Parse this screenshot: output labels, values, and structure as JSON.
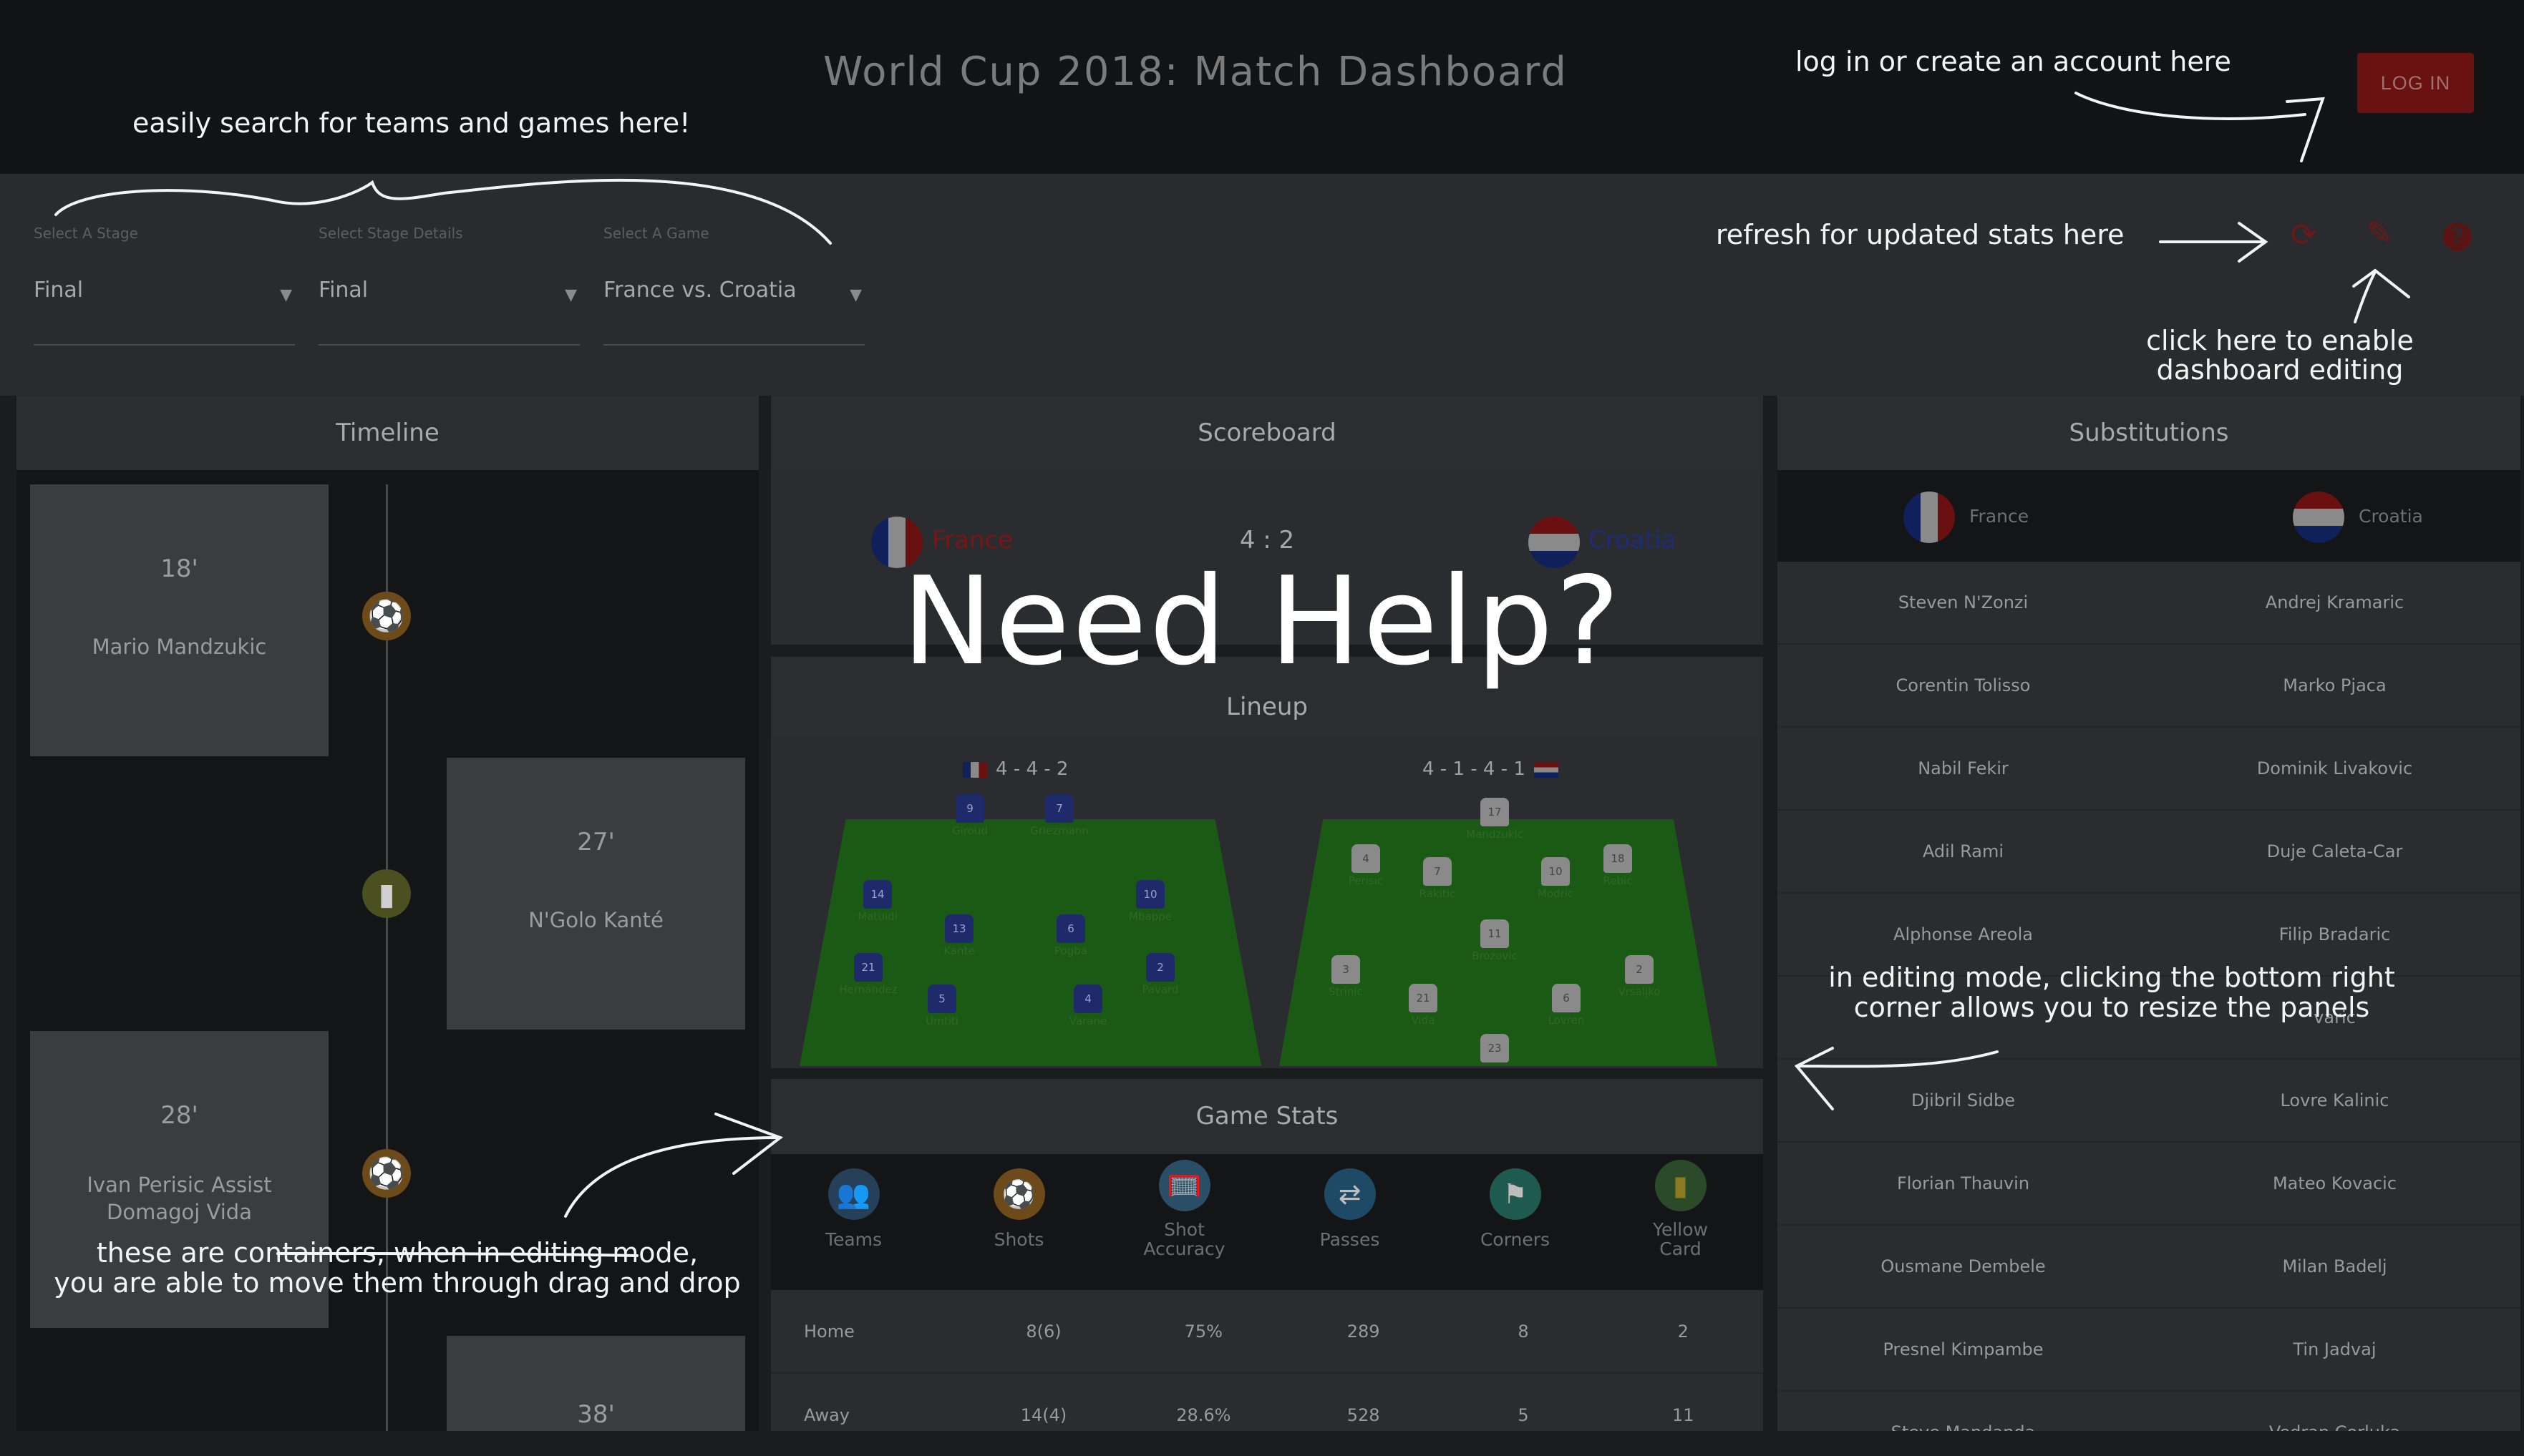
{
  "header": {
    "title": "World Cup 2018: Match Dashboard",
    "login_label": "LOG IN"
  },
  "filters": {
    "stage": {
      "label": "Select A Stage",
      "value": "Final"
    },
    "stage_details": {
      "label": "Select Stage Details",
      "value": "Final"
    },
    "game": {
      "label": "Select A Game",
      "value": "France vs. Croatia"
    }
  },
  "toolbar": {
    "refresh_icon": "refresh-icon",
    "edit_icon": "pencil-icon",
    "help_icon": "help-icon"
  },
  "timeline": {
    "title": "Timeline",
    "events": [
      {
        "minute": "18'",
        "text": "Mario Mandzukic"
      },
      {
        "minute": "27'",
        "text": "N'Golo Kanté"
      },
      {
        "minute": "28'",
        "text_line1": "Ivan Perisic Assist",
        "text_line2": "Domagoj Vida"
      },
      {
        "minute": "38'"
      }
    ]
  },
  "scoreboard": {
    "title": "Scoreboard",
    "home_team": "France",
    "away_team": "Croatia",
    "score": "4 : 2",
    "colors": {
      "home": "#7c1416",
      "away": "#1d2c7a"
    }
  },
  "lineup": {
    "title": "Lineup",
    "home_formation": "4 - 4 - 2",
    "away_formation": "4 - 1 - 4 - 1",
    "home_players": [
      {
        "num": "9",
        "name": "Giroud"
      },
      {
        "num": "7",
        "name": "Griezmann"
      },
      {
        "num": "14",
        "name": "Matuidi"
      },
      {
        "num": "10",
        "name": "Mbappe"
      },
      {
        "num": "13",
        "name": "Kante"
      },
      {
        "num": "6",
        "name": "Pogba"
      },
      {
        "num": "21",
        "name": "Hernández"
      },
      {
        "num": "5",
        "name": "Umtiti"
      },
      {
        "num": "4",
        "name": "Varane"
      },
      {
        "num": "2",
        "name": "Pavard"
      }
    ],
    "away_players": [
      {
        "num": "17",
        "name": "Mandzukic"
      },
      {
        "num": "4",
        "name": "Perisic"
      },
      {
        "num": "7",
        "name": "Rakitic"
      },
      {
        "num": "10",
        "name": "Modric"
      },
      {
        "num": "18",
        "name": "Rebic"
      },
      {
        "num": "11",
        "name": "Brozovic"
      },
      {
        "num": "3",
        "name": "Strinic"
      },
      {
        "num": "21",
        "name": "Vida"
      },
      {
        "num": "6",
        "name": "Lovren"
      },
      {
        "num": "2",
        "name": "Vrsaljko"
      },
      {
        "num": "23",
        "name": ""
      }
    ]
  },
  "game_stats": {
    "title": "Game Stats",
    "columns": [
      {
        "label": "Teams",
        "icon": "team-icon"
      },
      {
        "label": "Shots",
        "icon": "ball-icon"
      },
      {
        "label": "Shot Accuracy",
        "icon": "goal-net-icon"
      },
      {
        "label": "Passes",
        "icon": "pass-icon"
      },
      {
        "label": "Corners",
        "icon": "corner-flag-icon"
      },
      {
        "label": "Yellow Card",
        "icon": "yellow-card-icon"
      }
    ],
    "rows": [
      [
        "Home",
        "8(6)",
        "75%",
        "289",
        "8",
        "2"
      ],
      [
        "Away",
        "14(4)",
        "28.6%",
        "528",
        "5",
        "11"
      ]
    ]
  },
  "substitutions": {
    "title": "Substitutions",
    "home_team": "France",
    "away_team": "Croatia",
    "rows": [
      [
        "Steven N'Zonzi",
        "Andrej Kramaric"
      ],
      [
        "Corentin Tolisso",
        "Marko Pjaca"
      ],
      [
        "Nabil Fekir",
        "Dominik Livakovic"
      ],
      [
        "Adil Rami",
        "Duje Caleta-Car"
      ],
      [
        "Alphonse Areola",
        "Filip Bradaric"
      ],
      [
        "",
        "varic"
      ],
      [
        "Djibril Sidbe",
        "Lovre Kalinic"
      ],
      [
        "Florian Thauvin",
        "Mateo Kovacic"
      ],
      [
        "Ousmane Dembele",
        "Milan Badelj"
      ],
      [
        "Presnel Kimpambe",
        "Tin Jadvaj"
      ],
      [
        "Steve Mandanda",
        "Vedran Corluka"
      ]
    ]
  },
  "help_overlay": {
    "heading": "Need Help?",
    "hints": {
      "search": "easily search for teams and games here!",
      "login": "log in or create an account here",
      "refresh": "refresh for updated stats here",
      "edit_line1": "click here to enable",
      "edit_line2": "dashboard editing",
      "resize_line1": "in editing mode, clicking the bottom right",
      "resize_line2": "corner allows you to resize the panels",
      "drag_line1": "these are containers, when in editing mode,",
      "drag_line2": "you are able to move them through drag and drop"
    }
  }
}
